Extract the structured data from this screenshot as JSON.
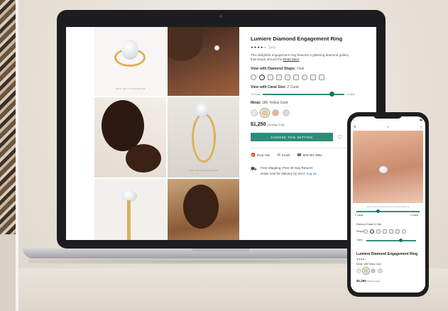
{
  "product": {
    "title": "Lumiere Diamond Engagement Ring",
    "stars": "★★★★☆",
    "review_count": "(12)",
    "description": "This delightful engagement ring features a glittering diamond gallery that wraps around the",
    "read_more": "Read More",
    "shape_label": "View with Diamond Shape:",
    "shape_value": "Oval",
    "carat_label": "View with Carat Size:",
    "carat_value": "2 Carat",
    "carat_min": "1/3 Carat",
    "carat_max": "3 Carat",
    "carat_level": 0.85,
    "metal_label": "Metal:",
    "metal_value": "18K Yellow Gold",
    "price": "$1,250",
    "price_note": "(Setting Only)",
    "cta": "CHOOSE THIS SETTING",
    "drop_hint": "Drop Hint",
    "email": "Email",
    "phone": "800.691.0952",
    "shipping_line1": "Free Shipping, Free 30 Day Returns",
    "shipping_line2_prefix": "Order now for delivery by",
    "shipping_date": "Wed, Aug 16."
  },
  "tiles": {
    "caption_1": "Shown with 2.0 Carat Diamond",
    "caption_4": "Shown with 1.5 Carat Diamond"
  },
  "colors": {
    "accent": "#2d8c78",
    "metal_white": "#e6e6e6",
    "metal_yellow": "#e9cf86",
    "metal_rose": "#e8b39a",
    "metal_platinum": "#d8d8d8"
  },
  "icons": [
    "heart-icon",
    "gift-icon",
    "mail-icon",
    "phone-icon",
    "truck-icon"
  ],
  "phone_view": {
    "caption": "Shown with 2.0 Carat Diamond Round Diamond",
    "size_min": "1 Carat",
    "size_max": "3 Carat",
    "shape_label": "Diamond Shape & Size",
    "shape_row": "Shape",
    "carat_row": "Carat",
    "title": "Lumiere Diamond Engagement Ring",
    "stars": "★★★★☆",
    "metal": "Metal: 18K Yellow Gold",
    "price": "$1,250",
    "price_note": "(Setting Only)"
  }
}
